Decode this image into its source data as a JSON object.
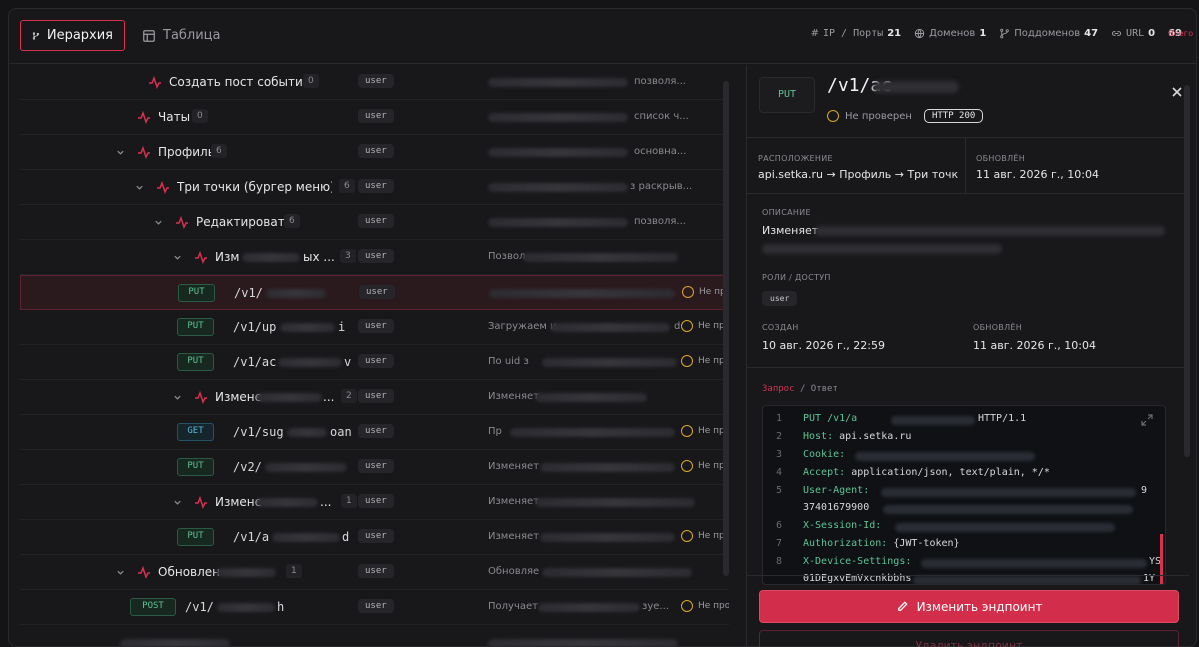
{
  "tabs": [
    {
      "label": "Иерархия",
      "active": true,
      "icon": "branch-icon"
    },
    {
      "label": "Таблица",
      "active": false,
      "icon": "table-icon"
    }
  ],
  "stats": {
    "ip_label": "IP / Порты",
    "ip_value": "21",
    "domains_label": "Доменов",
    "domains_value": "1",
    "subdomains_label": "Поддоменов",
    "subdomains_value": "47",
    "url_label": "URL",
    "url_value": "0",
    "total_label": "Всего",
    "total_value": "69"
  },
  "tree_rows": [
    {
      "name": "Создать пост событие",
      "count": "0",
      "role": "user",
      "desc": "позволя..."
    },
    {
      "name": "Чаты",
      "count": "0",
      "role": "user",
      "desc": "список ч..."
    },
    {
      "name": "Профиль",
      "count": "6",
      "role": "user",
      "desc": "основна..."
    },
    {
      "name": "Три точки (бургер меню) в ...",
      "count": "6",
      "role": "user",
      "desc": "з раскрыв..."
    },
    {
      "name": "Редактировать",
      "count": "6",
      "role": "user",
      "desc": "позволя..."
    },
    {
      "name": "Изм",
      "name_end": "ых ...",
      "count": "3",
      "role": "user",
      "desc": "Позвол"
    },
    {
      "method": "PUT",
      "path": "/v1/",
      "role": "user",
      "desc": "",
      "status": "Не пров"
    },
    {
      "method": "PUT",
      "path": "/v1/up",
      "path_end": "i",
      "role": "user",
      "desc": "Загружаем и",
      "desc_end": "d",
      "status": "Не пров"
    },
    {
      "method": "PUT",
      "path": "/v1/ac",
      "path_end": "v",
      "role": "user",
      "desc": "По uid з",
      "status": "Не пров"
    },
    {
      "name": "Измене",
      "name_end": "...",
      "count": "2",
      "role": "user",
      "desc": "Изменяет"
    },
    {
      "method": "GET",
      "path": "/v1/sug",
      "path_end": "oan",
      "role": "user",
      "desc": "Пр",
      "status": "Не пров"
    },
    {
      "method": "PUT",
      "path": "/v2/",
      "role": "user",
      "desc": "Изменяет",
      "status": "Не пров"
    },
    {
      "name": "Измене",
      "name_end": "...",
      "count": "1",
      "role": "user",
      "desc": "Изменяет"
    },
    {
      "method": "PUT",
      "path": "/v1/a",
      "path_end": "d",
      "role": "user",
      "desc": "Изменяет",
      "status": "Не пров"
    },
    {
      "name": "Обновлен",
      "count": "1",
      "role": "user",
      "desc": "Обновляе"
    },
    {
      "method": "POST",
      "path": "/v1/",
      "path_end": "h",
      "role": "user",
      "desc": "Получает",
      "desc_end": "зуе...",
      "status": "Не пров"
    }
  ],
  "detail": {
    "method": "PUT",
    "title": "/v1/ac",
    "status": "Не проверен",
    "http": "HTTP 200",
    "location_label": "РАСПОЛОЖЕНИЕ",
    "location_value": "api.setka.ru → Профиль → Три точки...",
    "updated_label": "ОБНОВЛЁН",
    "updated_value": "11 авг. 2026 г., 10:04",
    "description_label": "ОПИСАНИЕ",
    "description_value": "Изменяет",
    "roles_label": "РОЛИ / ДОСТУП",
    "role": "user",
    "created_label": "СОЗДАН",
    "created_value": "10 авг. 2026 г., 22:59",
    "updated2_label": "ОБНОВЛЁН",
    "updated2_value": "11 авг. 2026 г., 10:04",
    "req_tab": "Запрос",
    "resp_tab": "Ответ",
    "code_lines": [
      {
        "n": "1",
        "key": "PUT /v1/a",
        "val": "HTTP/1.1"
      },
      {
        "n": "2",
        "key": "Host:",
        "val": "api.setka.ru"
      },
      {
        "n": "3",
        "key": "Cookie:",
        "val": ""
      },
      {
        "n": "4",
        "key": "Accept:",
        "val": "application/json, text/plain, */*"
      },
      {
        "n": "5",
        "key": "User-Agent:",
        "val": "9"
      },
      {
        "n": "",
        "key": "",
        "val": "37401679900"
      },
      {
        "n": "6",
        "key": "X-Session-Id:",
        "val": ""
      },
      {
        "n": "7",
        "key": "Authorization:",
        "val": "{JWT-token}"
      },
      {
        "n": "8",
        "key": "X-Device-Settings:",
        "val": "YS"
      },
      {
        "n": "",
        "key": "",
        "val": "01DEgxvEmVxcnkbbhs",
        "val_end": "1Y"
      }
    ],
    "edit_button": "Изменить эндпоинт",
    "second_button": "Удалить эндпоинт"
  },
  "colors": {
    "accent": "#d22d4a",
    "put": "#5ec394",
    "get": "#5fb4d8",
    "pending": "#d9a72b"
  }
}
